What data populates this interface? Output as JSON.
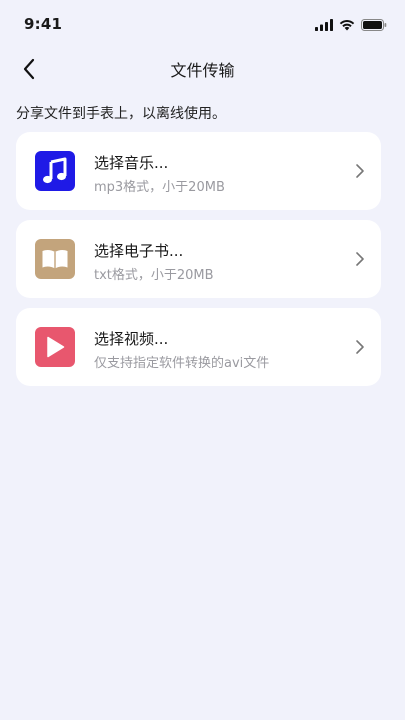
{
  "status_bar": {
    "time": "9:41"
  },
  "nav": {
    "title": "文件传输"
  },
  "subtitle": "分享文件到手表上，以离线使用。",
  "items": [
    {
      "title": "选择音乐...",
      "description": "mp3格式，小于20MB",
      "icon": "music-note-icon",
      "color": "#1f1ae6"
    },
    {
      "title": "选择电子书...",
      "description": "txt格式，小于20MB",
      "icon": "book-icon",
      "color": "#c3a47c"
    },
    {
      "title": "选择视频...",
      "description": "仅支持指定软件转换的avi文件",
      "icon": "play-icon",
      "color": "#e8576e"
    }
  ]
}
